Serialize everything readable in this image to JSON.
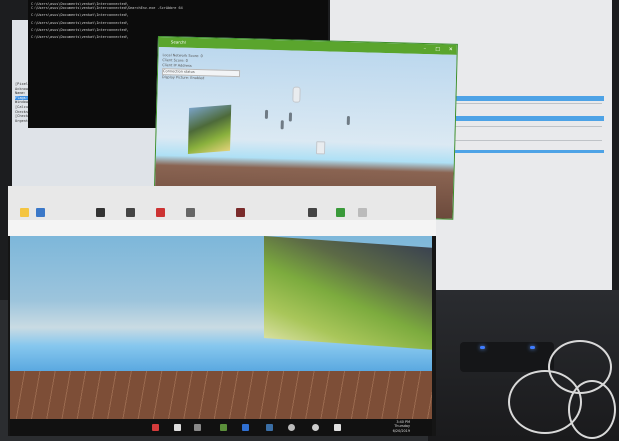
{
  "scene": "photo-of-two-monitors-and-laptop",
  "colors": {
    "titlebar_green": "#5aa52d",
    "selection_blue": "#4ea3e6",
    "taskbar": "#111111",
    "router_led": "#3f7cff"
  },
  "terminal": {
    "lines": [
      "C:\\Users\\asus\\Documents\\venkat\\Interconnected\\",
      "C:\\Users\\asus\\Documents\\venkat\\Interconnected\\SearchEnv.exe -ScrAbbre 64",
      "C:\\Users\\asus\\Documents\\venkat\\Interconnected\\",
      "C:\\Users\\asus\\Documents\\venkat\\Interconnected\\",
      "C:\\Users\\asus\\Documents\\venkat\\Interconnected\\",
      "C:\\Users\\asus\\Documents\\venkat\\Interconnected\\"
    ]
  },
  "left_doc": {
    "lines": [
      "[Pixel results number]: 0",
      "Acknowledgement number: 0",
      "Name:            Device length: 16 Header",
      "Flags: Model Items",
      "Window Size value: 64240",
      "[Calculated window size: 64240]",
      "Checksum: 0xa073 [unverified]",
      "[Checksum Status: Unverified]",
      "Urgent pointer: 0"
    ],
    "highlight_index": 3
  },
  "game_window": {
    "title": "SearchI",
    "controls": [
      "minimize-icon",
      "maximize-icon",
      "close-icon"
    ],
    "info_lines": [
      "Local Network Score: 0",
      "Client Score: 0",
      "Client IP Address",
      "Connection status",
      "Display Picture: Enabled"
    ]
  },
  "taskbar": {
    "time": "3:40 PM",
    "day": "Thursday",
    "date": "6/20/2019"
  }
}
